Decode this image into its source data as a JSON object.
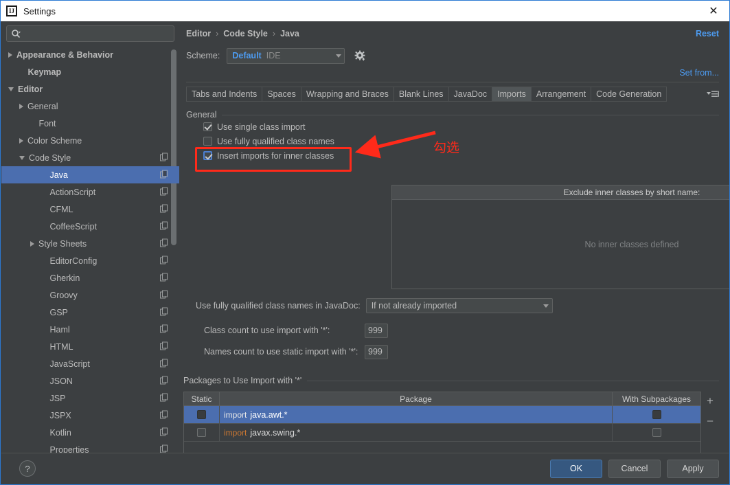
{
  "window": {
    "title": "Settings",
    "app_icon": "intellij-idea-icon",
    "close_label": "✕"
  },
  "sidebar": {
    "search": {
      "placeholder": "",
      "value": "",
      "icon": "search-icon"
    },
    "items": [
      {
        "label": "Appearance & Behavior",
        "indent": 0,
        "twisty": "right",
        "bold": true,
        "copy": false,
        "selected": false
      },
      {
        "label": "Keymap",
        "indent": 1,
        "twisty": "none",
        "bold": true,
        "copy": false,
        "selected": false
      },
      {
        "label": "Editor",
        "indent": 0,
        "twisty": "down",
        "bold": true,
        "copy": false,
        "selected": false
      },
      {
        "label": "General",
        "indent": 1,
        "twisty": "right",
        "bold": false,
        "copy": false,
        "selected": false
      },
      {
        "label": "Font",
        "indent": 2,
        "twisty": "none",
        "bold": false,
        "copy": false,
        "selected": false
      },
      {
        "label": "Color Scheme",
        "indent": 1,
        "twisty": "right",
        "bold": false,
        "copy": false,
        "selected": false
      },
      {
        "label": "Code Style",
        "indent": 1,
        "twisty": "down",
        "bold": false,
        "copy": true,
        "selected": false
      },
      {
        "label": "Java",
        "indent": 3,
        "twisty": "none",
        "bold": false,
        "copy": true,
        "selected": true
      },
      {
        "label": "ActionScript",
        "indent": 3,
        "twisty": "none",
        "bold": false,
        "copy": true,
        "selected": false
      },
      {
        "label": "CFML",
        "indent": 3,
        "twisty": "none",
        "bold": false,
        "copy": true,
        "selected": false
      },
      {
        "label": "CoffeeScript",
        "indent": 3,
        "twisty": "none",
        "bold": false,
        "copy": true,
        "selected": false
      },
      {
        "label": "Style Sheets",
        "indent": 2,
        "twisty": "right",
        "bold": false,
        "copy": true,
        "selected": false
      },
      {
        "label": "EditorConfig",
        "indent": 3,
        "twisty": "none",
        "bold": false,
        "copy": true,
        "selected": false
      },
      {
        "label": "Gherkin",
        "indent": 3,
        "twisty": "none",
        "bold": false,
        "copy": true,
        "selected": false
      },
      {
        "label": "Groovy",
        "indent": 3,
        "twisty": "none",
        "bold": false,
        "copy": true,
        "selected": false
      },
      {
        "label": "GSP",
        "indent": 3,
        "twisty": "none",
        "bold": false,
        "copy": true,
        "selected": false
      },
      {
        "label": "Haml",
        "indent": 3,
        "twisty": "none",
        "bold": false,
        "copy": true,
        "selected": false
      },
      {
        "label": "HTML",
        "indent": 3,
        "twisty": "none",
        "bold": false,
        "copy": true,
        "selected": false
      },
      {
        "label": "JavaScript",
        "indent": 3,
        "twisty": "none",
        "bold": false,
        "copy": true,
        "selected": false
      },
      {
        "label": "JSON",
        "indent": 3,
        "twisty": "none",
        "bold": false,
        "copy": true,
        "selected": false
      },
      {
        "label": "JSP",
        "indent": 3,
        "twisty": "none",
        "bold": false,
        "copy": true,
        "selected": false
      },
      {
        "label": "JSPX",
        "indent": 3,
        "twisty": "none",
        "bold": false,
        "copy": true,
        "selected": false
      },
      {
        "label": "Kotlin",
        "indent": 3,
        "twisty": "none",
        "bold": false,
        "copy": true,
        "selected": false
      },
      {
        "label": "Properties",
        "indent": 3,
        "twisty": "none",
        "bold": false,
        "copy": true,
        "selected": false
      }
    ]
  },
  "header": {
    "breadcrumb": [
      "Editor",
      "Code Style",
      "Java"
    ],
    "breadcrumb_separator": "›",
    "reset_label": "Reset",
    "scheme_label": "Scheme:",
    "scheme_value": "Default",
    "scheme_scope": "IDE",
    "scheme_gear_icon": "gear-icon",
    "set_from_label": "Set from..."
  },
  "tabs": {
    "items": [
      "Tabs and Indents",
      "Spaces",
      "Wrapping and Braces",
      "Blank Lines",
      "JavaDoc",
      "Imports",
      "Arrangement",
      "Code Generation"
    ],
    "active": "Imports",
    "overflow_icon": "tab-list-icon"
  },
  "general": {
    "title": "General",
    "checkboxes": [
      {
        "label": "Use single class import",
        "checked": true,
        "focused": false
      },
      {
        "label": "Use fully qualified class names",
        "checked": false,
        "focused": false
      },
      {
        "label": "Insert imports for inner classes",
        "checked": true,
        "focused": true
      }
    ]
  },
  "annotation": {
    "text": "勾选",
    "color": "#ff2a1a",
    "arrow_icon": "red-arrow-icon",
    "box_icon": "red-highlight-box"
  },
  "exclude": {
    "header": "Exclude inner classes by short name:",
    "empty_text": "No inner classes defined",
    "add_label": "+",
    "remove_label": "–"
  },
  "form": {
    "javadoc_label": "Use fully qualified class names in JavaDoc:",
    "javadoc_value": "If not already imported",
    "class_count_label": "Class count to use import with '*':",
    "class_count_value": "999",
    "names_count_label": "Names count to use static import with '*':",
    "names_count_value": "999"
  },
  "packages": {
    "title": "Packages to Use Import with '*'",
    "columns": [
      "Static",
      "Package",
      "With Subpackages"
    ],
    "rows": [
      {
        "static": false,
        "keyword": "import",
        "package": "java.awt.*",
        "subpackages": false,
        "selected": true
      },
      {
        "static": false,
        "keyword": "import",
        "package": "javax.swing.*",
        "subpackages": false,
        "selected": false
      }
    ],
    "add_label": "+",
    "remove_label": "–"
  },
  "footer": {
    "help_label": "?",
    "ok_label": "OK",
    "cancel_label": "Cancel",
    "apply_label": "Apply"
  }
}
